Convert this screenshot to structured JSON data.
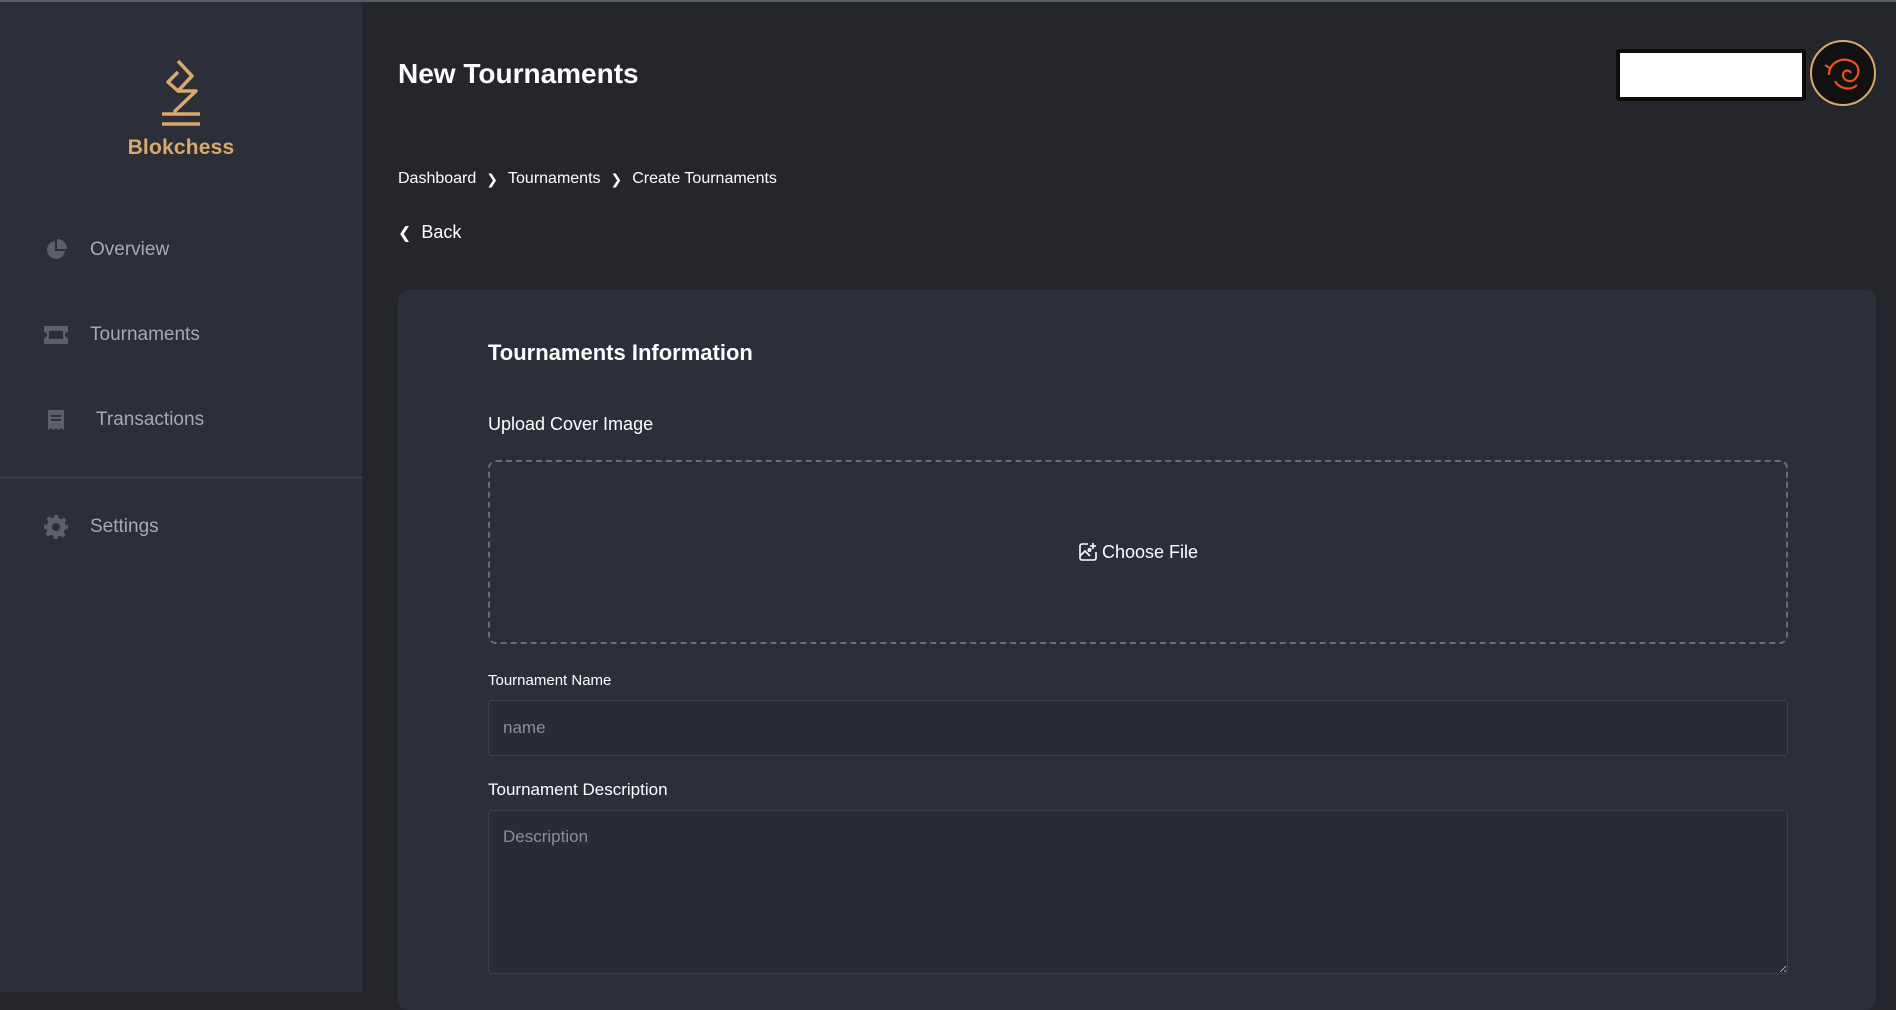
{
  "app": {
    "brand": "Blokchess"
  },
  "sidebar": {
    "items": [
      {
        "label": "Overview",
        "icon": "pie-chart-icon"
      },
      {
        "label": "Tournaments",
        "icon": "ticket-icon"
      },
      {
        "label": "Transactions",
        "icon": "receipt-icon"
      },
      {
        "label": "Settings",
        "icon": "gear-icon"
      }
    ]
  },
  "header": {
    "title": "New Tournaments"
  },
  "breadcrumb": {
    "items": [
      "Dashboard",
      "Tournaments",
      "Create Tournaments"
    ]
  },
  "back": {
    "label": "Back"
  },
  "form": {
    "section_title": "Tournaments Information",
    "upload_label": "Upload Cover Image",
    "choose_file": "Choose File",
    "name_label": "Tournament Name",
    "name_placeholder": "name",
    "name_value": "",
    "desc_label": "Tournament Description",
    "desc_placeholder": "Description",
    "desc_value": ""
  },
  "colors": {
    "accent": "#d9a86c",
    "background": "#25262c",
    "panel": "#2c2f37"
  }
}
